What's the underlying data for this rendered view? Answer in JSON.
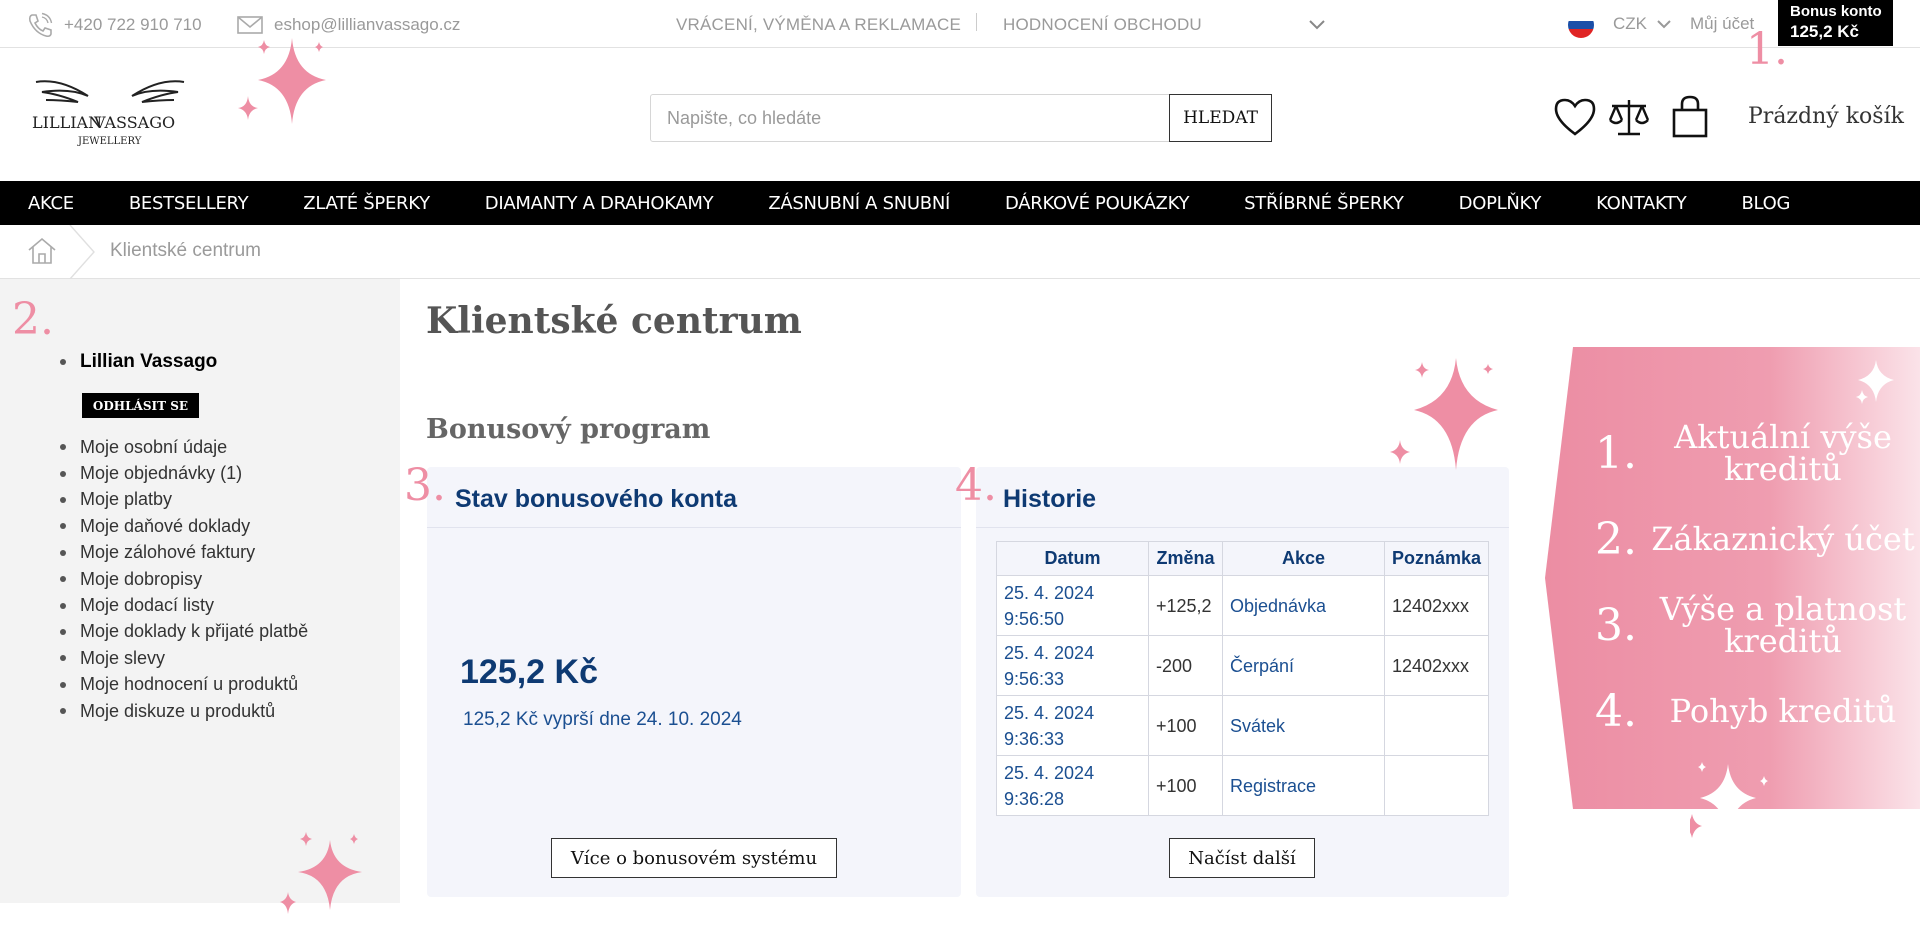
{
  "topbar": {
    "phone": "+420 722 910 710",
    "email": "eshop@lillianvassago.cz",
    "links": [
      "VRÁCENÍ, VÝMĚNA A REKLAMACE",
      "HODNOCENÍ OBCHODU"
    ],
    "currency": "CZK",
    "account": "Můj účet",
    "bonus_label": "Bonus konto",
    "bonus_value": "125,2 Kč"
  },
  "logo": {
    "brand_line1": "LILLIAN",
    "brand_line2": "VASSAGO",
    "brand_sub": "JEWELLERY"
  },
  "search": {
    "placeholder": "Napište, co hledáte",
    "button": "HLEDAT"
  },
  "cart": {
    "label": "Prázdný košík"
  },
  "nav": [
    "AKCE",
    "BESTSELLERY",
    "ZLATÉ ŠPERKY",
    "DIAMANTY A DRAHOKAMY",
    "ZÁSNUBNÍ A SNUBNÍ",
    "DÁRKOVÉ POUKÁZKY",
    "STŘÍBRNÉ ŠPERKY",
    "DOPLŇKY",
    "KONTAKTY",
    "BLOG"
  ],
  "breadcrumb": {
    "current": "Klientské centrum"
  },
  "sidebar": {
    "user": "Lillian Vassago",
    "logout": "ODHLÁSIT SE",
    "items": [
      "Moje osobní údaje",
      "Moje objednávky (1)",
      "Moje platby",
      "Moje daňové doklady",
      "Moje zálohové faktury",
      "Moje dobropisy",
      "Moje dodací listy",
      "Moje doklady k přijaté platbě",
      "Moje slevy",
      "Moje hodnocení u produktů",
      "Moje diskuze u produktů"
    ]
  },
  "main": {
    "title": "Klientské centrum",
    "section": "Bonusový program",
    "account_card": {
      "heading": "Stav bonusového konta",
      "balance": "125,2 Kč",
      "expiry": "125,2 Kč vyprší dne 24. 10. 2024",
      "button": "Více o bonusovém systému"
    },
    "history_card": {
      "heading": "Historie",
      "columns": [
        "Datum",
        "Změna",
        "Akce",
        "Poznámka"
      ],
      "rows": [
        {
          "date": "25. 4. 2024",
          "time": "9:56:50",
          "change": "+125,2",
          "action": "Objednávka",
          "note": "12402xxx"
        },
        {
          "date": "25. 4. 2024",
          "time": "9:56:33",
          "change": "-200",
          "action": "Čerpání",
          "note": "12402xxx"
        },
        {
          "date": "25. 4. 2024",
          "time": "9:36:33",
          "change": "+100",
          "action": "Svátek",
          "note": ""
        },
        {
          "date": "25. 4. 2024",
          "time": "9:36:28",
          "change": "+100",
          "action": "Registrace",
          "note": ""
        }
      ],
      "button": "Načíst další"
    }
  },
  "markers": [
    "1.",
    "2.",
    "3.",
    "4."
  ],
  "promo": {
    "items": [
      {
        "num": "1.",
        "text": "Aktuální výše kreditů"
      },
      {
        "num": "2.",
        "text": "Zákaznický účet"
      },
      {
        "num": "3.",
        "text": "Výše a platnost kreditů"
      },
      {
        "num": "4.",
        "text": "Pohyb kreditů"
      }
    ]
  },
  "colors": {
    "accent_pink": "#ee8ea4",
    "navy": "#0e3a73",
    "nav_bg": "#000000"
  },
  "icons": [
    "phone-icon",
    "mail-icon",
    "chevron-down-icon",
    "flag-sk-icon",
    "heart-icon",
    "scales-icon",
    "shopping-bag-icon",
    "home-icon",
    "sparkle-icon"
  ]
}
